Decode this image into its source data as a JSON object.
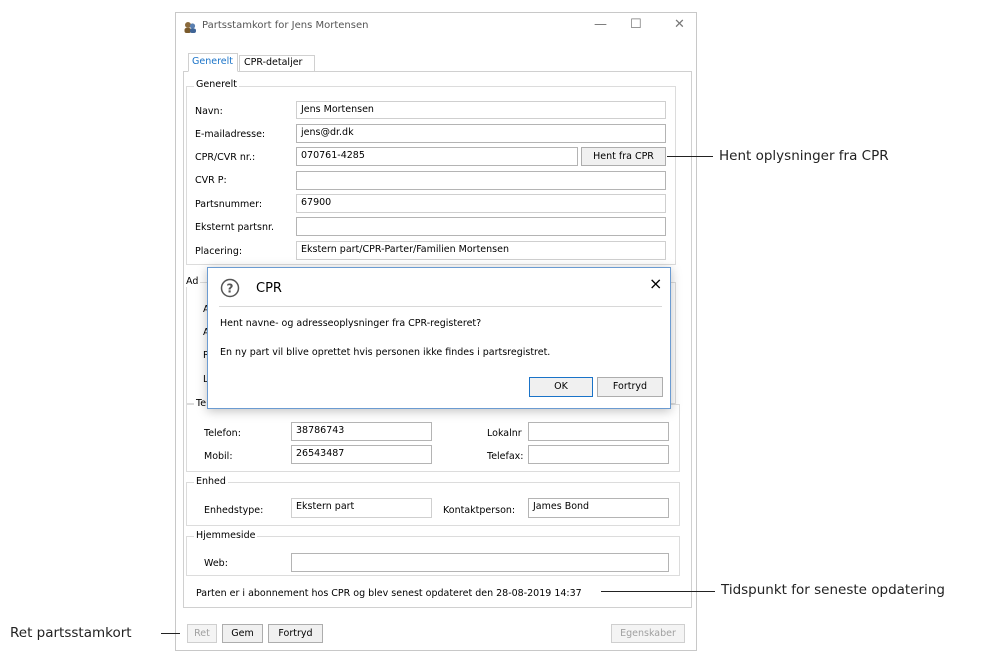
{
  "window": {
    "title": "Partsstamkort for Jens Mortensen",
    "controls": {
      "minimize": "—",
      "maximize": "☐",
      "close": "✕"
    }
  },
  "tabs": [
    {
      "label": "Generelt",
      "active": true
    },
    {
      "label": "CPR-detaljer",
      "active": false
    }
  ],
  "general": {
    "group_title": "Generelt",
    "rows": [
      {
        "label": "Navn:",
        "value": "Jens Mortensen"
      },
      {
        "label": "E-mailadresse:",
        "value": "jens@dr.dk"
      },
      {
        "label": "CPR/CVR nr.:",
        "value": "070761-4285"
      },
      {
        "label": "CVR P:",
        "value": ""
      },
      {
        "label": "Partsnummer:",
        "value": "67900"
      },
      {
        "label": "Eksternt partsnr.",
        "value": ""
      },
      {
        "label": "Placering:",
        "value": "Ekstern part/CPR-Parter/Familien Mortensen"
      }
    ],
    "hent_button": "Hent fra CPR"
  },
  "hidden_group": {
    "title_partial": "Ad",
    "letters": [
      "A",
      "A",
      "P",
      "L"
    ]
  },
  "phone": {
    "title_partial": "Te",
    "telefon_label": "Telefon:",
    "telefon_value": "38786743",
    "mobil_label": "Mobil:",
    "mobil_value": "26543487",
    "lokalnr_label": "Lokalnr",
    "lokalnr_value": "",
    "telefax_label": "Telefax:",
    "telefax_value": ""
  },
  "enhed": {
    "title": "Enhed",
    "type_label": "Enhedstype:",
    "type_value": "Ekstern part",
    "kontakt_label": "Kontaktperson:",
    "kontakt_value": "James Bond"
  },
  "hjemmeside": {
    "title": "Hjemmeside",
    "web_label": "Web:",
    "web_value": ""
  },
  "status": "Parten er i abonnement hos CPR og blev senest opdateret den 28-08-2019 14:37",
  "footer": {
    "ret": "Ret",
    "gem": "Gem",
    "fortryd": "Fortryd",
    "egenskaber": "Egenskaber"
  },
  "dialog": {
    "title": "CPR",
    "close": "×",
    "icon": "question-icon",
    "message1": "Hent navne- og adresseoplysninger fra CPR-registeret?",
    "message2": "En ny part vil blive oprettet hvis personen ikke findes i partsregistret.",
    "ok": "OK",
    "cancel": "Fortryd"
  },
  "annotations": {
    "hent": "Hent oplysninger fra CPR",
    "tidspunkt": "Tidspunkt for seneste opdatering",
    "ret": "Ret partsstamkort"
  },
  "colors": {
    "accent": "#1a73c8",
    "dialog_border": "#6b9bd1"
  }
}
